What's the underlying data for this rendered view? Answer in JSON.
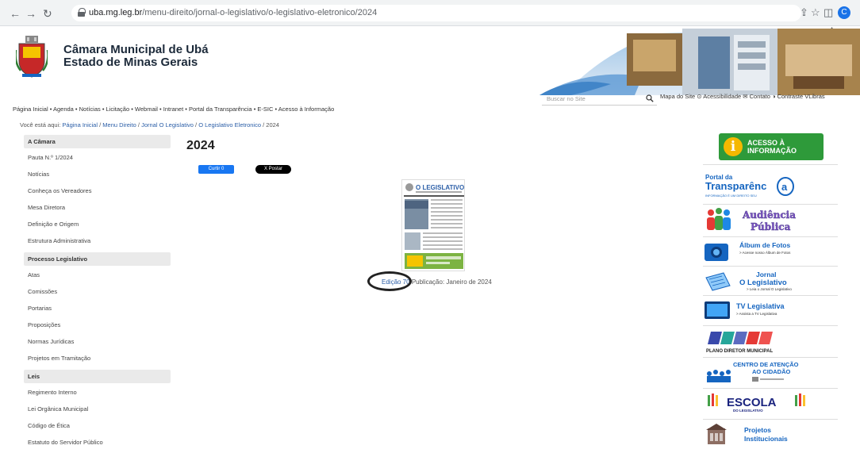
{
  "browser": {
    "url_host": "uba.mg.leg.br",
    "url_path": "/menu-direito/jornal-o-legislativo/o-legislativo-eletronico/2024",
    "profile_initial": "C"
  },
  "header": {
    "title_line1": "Câmara Municipal de Ubá",
    "title_line2": "Estado de Minas Gerais",
    "acessar": "Acessar"
  },
  "top_menu": "Página Inicial  •  Agenda  •  Notícias  •  Licitação  •  Webmail  •  Intranet  •  Portal da Transparência  •  E-SIC  •  Acesso à Informação",
  "search": {
    "placeholder": "Buscar no Site"
  },
  "utility": "Mapa do Site  ⊙ Acessibilidade  ✉ Contato  ◑ Contraste  VLibras",
  "breadcrumb": {
    "prefix": "Você está aqui:",
    "items": [
      "Página Inicial",
      "Menu Direito",
      "Jornal O Legislativo",
      "O Legislativo Eletronico"
    ],
    "current": "2024"
  },
  "sidebar": {
    "sections": [
      {
        "title": "A Câmara",
        "items": [
          "Pauta N.º 1/2024",
          "Notícias",
          "Conheça os Vereadores",
          "Mesa Diretora",
          "Definição e Origem",
          "Estrutura Administrativa"
        ]
      },
      {
        "title": "Processo Legislativo",
        "items": [
          "Atas",
          "Comissões",
          "Portarias",
          "Proposições",
          "Normas Jurídicas",
          "Projetos em Tramitação"
        ]
      },
      {
        "title": "Leis",
        "items": [
          "Regimento Interno",
          "Lei Orgânica Municipal",
          "Código de Ética",
          "Estatuto do Servidor Público"
        ]
      }
    ]
  },
  "main": {
    "title": "2024",
    "like_label": "Curtir 0",
    "post_label": "X Postar",
    "thumb_masthead": "O LEGISLATIVO",
    "edition_link": "Edição 70",
    "edition_date": " Publicação: Janeiro de 2024"
  },
  "right": {
    "acesso_line1": "ACESSO À",
    "acesso_line2": "INFORMAÇÃO",
    "transparencia_line1": "Portal da",
    "transparencia_line2": "Transparênc",
    "transparencia_sub": "INFORMAÇÃO É UM DIREITO SEU",
    "audiencia_line1": "Audiência",
    "audiencia_line2": "Pública",
    "album_title": "Álbum de Fotos",
    "album_sub": "> Acesse nosso Álbum de Fotos",
    "jornal_line1": "Jornal",
    "jornal_line2": "O Legislativo",
    "jornal_sub": "> Leia o Jornal O Legislativo",
    "tv_title": "TV Legislativa",
    "tv_sub": "> Assista a TV Legislativa",
    "plano": "PLANO DIRETOR MUNICIPAL",
    "centro_line1": "CENTRO DE ATENÇÃO",
    "centro_line2": "AO CIDADÃO",
    "escola": "ESCOLA",
    "escola_sub": "DO LEGISLATIVO",
    "projetos_line1": "Projetos",
    "projetos_line2": "Institucionais"
  }
}
